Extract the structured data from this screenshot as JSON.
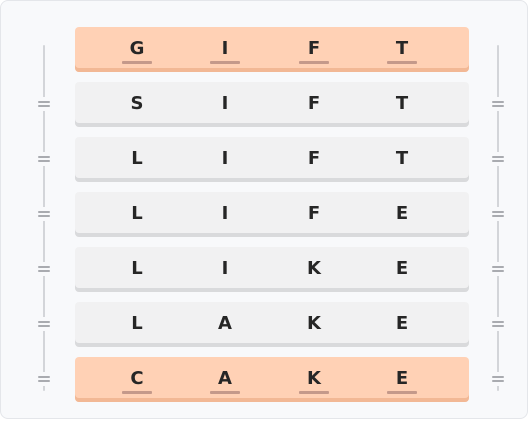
{
  "puzzle": {
    "rows": [
      {
        "letters": [
          "G",
          "I",
          "F",
          "T"
        ],
        "highlight": true
      },
      {
        "letters": [
          "S",
          "I",
          "F",
          "T"
        ],
        "highlight": false
      },
      {
        "letters": [
          "L",
          "I",
          "F",
          "T"
        ],
        "highlight": false
      },
      {
        "letters": [
          "L",
          "I",
          "F",
          "E"
        ],
        "highlight": false
      },
      {
        "letters": [
          "L",
          "I",
          "K",
          "E"
        ],
        "highlight": false
      },
      {
        "letters": [
          "L",
          "A",
          "K",
          "E"
        ],
        "highlight": false
      },
      {
        "letters": [
          "C",
          "A",
          "K",
          "E"
        ],
        "highlight": true
      }
    ],
    "colors": {
      "highlight_row": "#ffd1b5",
      "normal_row": "#f1f1f2",
      "letter": "#262626",
      "underline": "#c4998a"
    }
  }
}
